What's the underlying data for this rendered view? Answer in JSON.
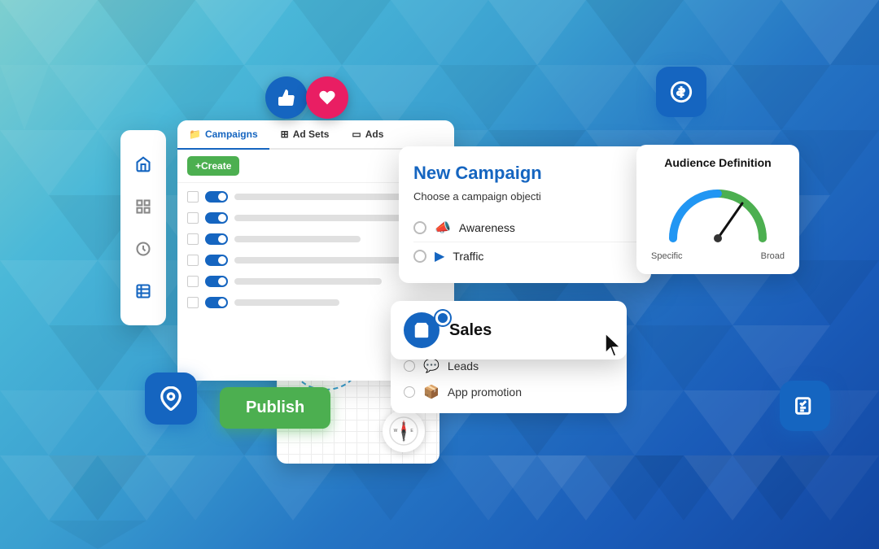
{
  "background": {
    "colors": [
      "#7ecfcf",
      "#4ab8d8",
      "#3a9fd0",
      "#2575c4",
      "#1245a0"
    ]
  },
  "sidebar": {
    "icons": [
      "home",
      "grid",
      "gauge",
      "table"
    ]
  },
  "campaign_panel": {
    "tabs": [
      {
        "label": "Campaigns",
        "icon": "📁",
        "active": true
      },
      {
        "label": "Ad Sets",
        "icon": "⊞",
        "active": false
      },
      {
        "label": "Ads",
        "icon": "▭",
        "active": false
      }
    ],
    "create_button": "+Create",
    "rows": [
      {
        "toggle": true
      },
      {
        "toggle": true
      },
      {
        "toggle": true
      },
      {
        "toggle": true
      },
      {
        "toggle": true
      },
      {
        "toggle": true
      }
    ]
  },
  "new_campaign": {
    "title": "New Campaign",
    "subtitle": "Choose a campaign objecti",
    "objectives": [
      {
        "label": "Awareness",
        "icon": "📣",
        "selected": false
      },
      {
        "label": "Traffic",
        "icon": "▶",
        "selected": false
      },
      {
        "label": "Sales",
        "icon": "🛍",
        "selected": true
      },
      {
        "label": "Leads",
        "icon": "💬",
        "selected": false
      },
      {
        "label": "App promotion",
        "icon": "📦",
        "selected": false
      }
    ]
  },
  "audience_definition": {
    "title": "Audience Definition",
    "label_specific": "Specific",
    "label_broad": "Broad"
  },
  "publish_button": {
    "label": "Publish"
  },
  "social_buttons": {
    "like": "👍",
    "heart": "❤️"
  },
  "fabs": {
    "dollar": "$",
    "location": "📍",
    "checklist": "✓"
  },
  "sales_card": {
    "label": "Sales"
  },
  "extra_objectives": [
    {
      "label": "Leads",
      "icon": "💬"
    },
    {
      "label": "App promotion",
      "icon": "📦"
    }
  ]
}
